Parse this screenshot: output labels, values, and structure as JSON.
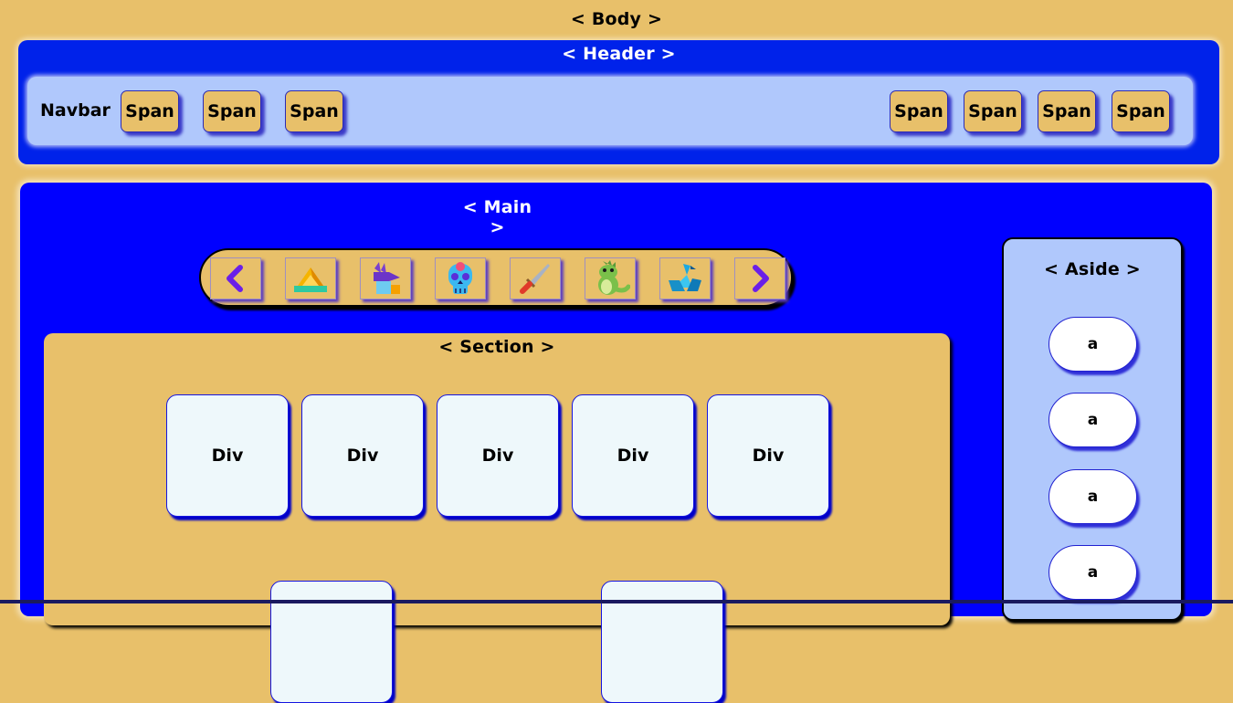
{
  "body_tag": "< Body >",
  "header": {
    "tag": "< Header >",
    "navbar": {
      "label": "Navbar",
      "left_spans": [
        "Span",
        "Span",
        "Span"
      ],
      "right_spans": [
        "Span",
        "Span",
        "Span",
        "Span"
      ]
    }
  },
  "main": {
    "tag": "< Main >",
    "carousel": {
      "prev_icon": "chevron-left-icon",
      "next_icon": "chevron-right-icon",
      "items": [
        "pyramid-icon",
        "anubis-icon",
        "sugar-skull-icon",
        "dagger-icon",
        "dinosaur-icon",
        "origami-bird-icon"
      ]
    },
    "section": {
      "tag": "< Section >",
      "divs": [
        "Div",
        "Div",
        "Div",
        "Div",
        "Div"
      ]
    },
    "aside": {
      "tag": "< Aside >",
      "links": [
        "a",
        "a",
        "a",
        "a"
      ]
    }
  },
  "colors": {
    "body_bg": "#e8c06a",
    "header_bg": "#0022ea",
    "navbar_bg": "#b0c8fc",
    "main_bg": "#0000ff",
    "card_bg": "#eef8fb",
    "chevron": "#6a1fe8"
  }
}
